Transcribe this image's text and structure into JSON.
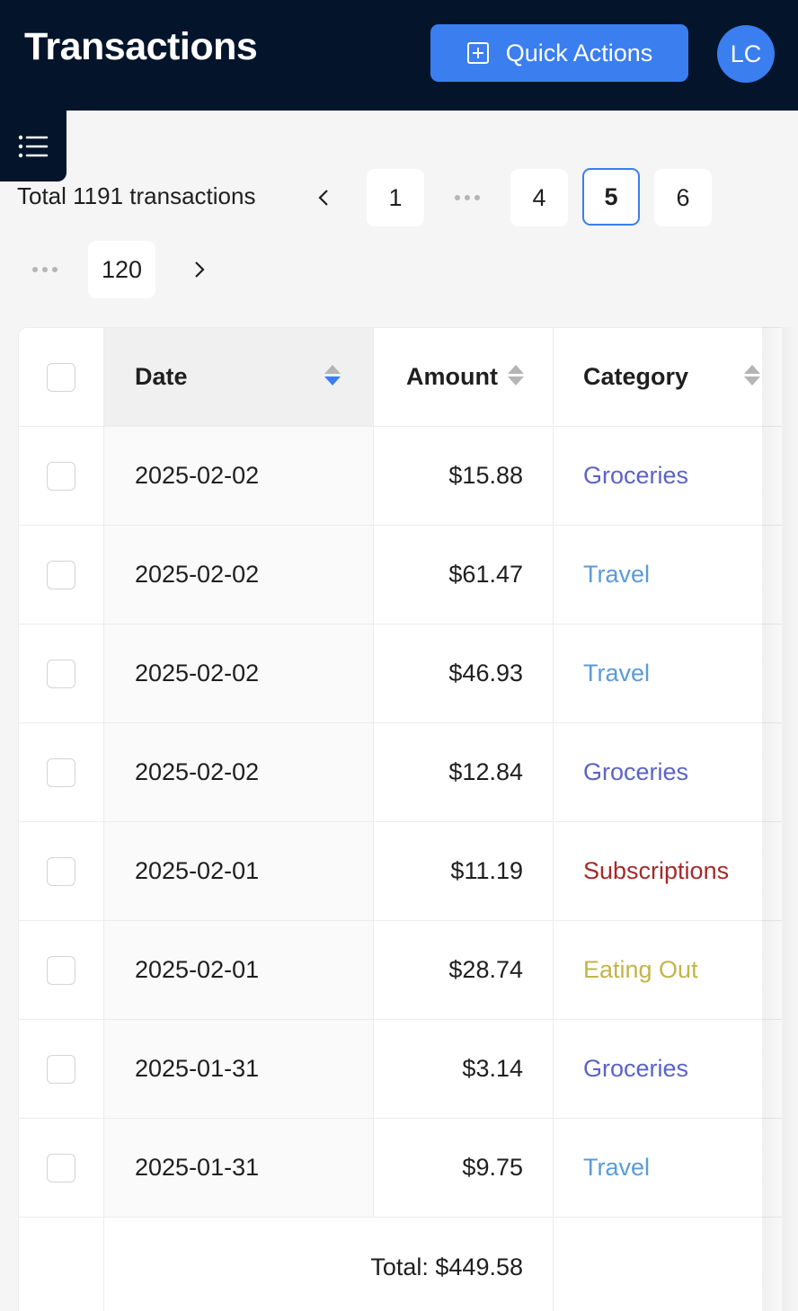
{
  "header": {
    "title": "Transactions",
    "quick_actions_label": "Quick Actions",
    "avatar_initials": "LC",
    "quick_actions_icon": "plus-square-icon",
    "menu_icon": "list-icon"
  },
  "pagination": {
    "total_label": "Total 1191 transactions",
    "prev_icon": "chevron-left-icon",
    "next_icon": "chevron-right-icon",
    "pages": [
      "1",
      "4",
      "5",
      "6",
      "120"
    ],
    "current_page": "5"
  },
  "table": {
    "columns": [
      "Date",
      "Amount",
      "Category"
    ],
    "sort": {
      "column": "Date",
      "direction": "descending"
    },
    "rows": [
      {
        "date": "2025-02-02",
        "amount": "$15.88",
        "category": "Groceries",
        "color": "#5b63c7"
      },
      {
        "date": "2025-02-02",
        "amount": "$61.47",
        "category": "Travel",
        "color": "#5a9bd8"
      },
      {
        "date": "2025-02-02",
        "amount": "$46.93",
        "category": "Travel",
        "color": "#5a9bd8"
      },
      {
        "date": "2025-02-02",
        "amount": "$12.84",
        "category": "Groceries",
        "color": "#5b63c7"
      },
      {
        "date": "2025-02-01",
        "amount": "$11.19",
        "category": "Subscriptions",
        "color": "#a52a2a"
      },
      {
        "date": "2025-02-01",
        "amount": "$28.74",
        "category": "Eating Out",
        "color": "#c2b54a"
      },
      {
        "date": "2025-01-31",
        "amount": "$3.14",
        "category": "Groceries",
        "color": "#5b63c7"
      },
      {
        "date": "2025-01-31",
        "amount": "$9.75",
        "category": "Travel",
        "color": "#5a9bd8"
      }
    ],
    "footer_total": "Total: $449.58"
  },
  "colors": {
    "header_bg": "#03142b",
    "accent": "#3a7ef0"
  }
}
